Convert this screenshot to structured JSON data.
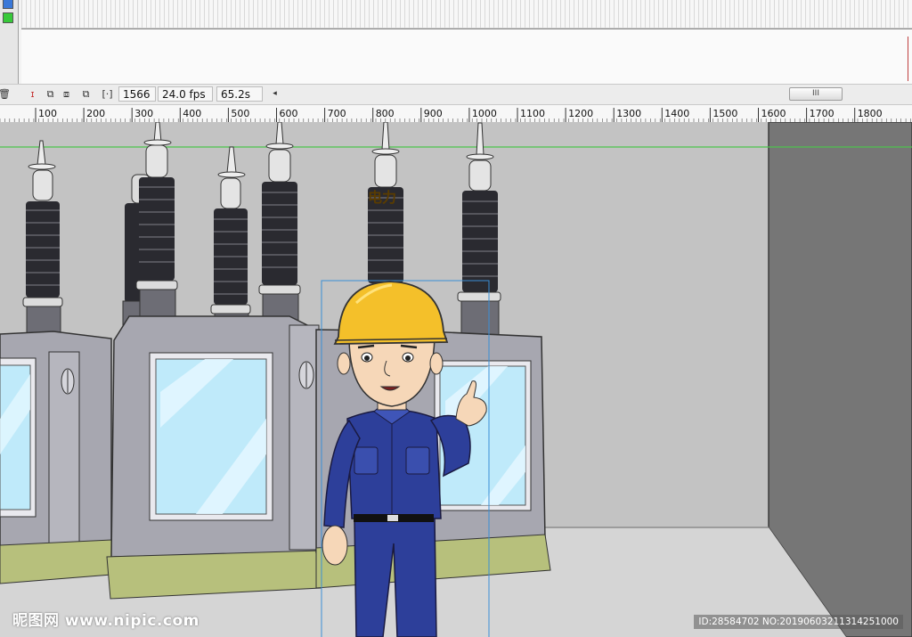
{
  "timeline": {
    "frame": "1566",
    "fps": "24.0 fps",
    "time": "65.2s",
    "scroll_label": "III",
    "layer_colors": [
      "#3a78d8",
      "#37c93a"
    ]
  },
  "ruler": {
    "ticks": [
      "100",
      "200",
      "300",
      "400",
      "500",
      "600",
      "700",
      "800",
      "900",
      "1000",
      "1100",
      "1200",
      "1300",
      "1400",
      "1500",
      "1600",
      "1700",
      "1800"
    ]
  },
  "scene": {
    "helmet_label": "电力",
    "colors": {
      "wall": "#c3c3c3",
      "side_wall": "#767676",
      "floor": "#d5d5d5",
      "helmet": "#f4c02a",
      "uniform": "#2d3f9a",
      "glass": "#bfeafa",
      "cabinet": "#a7a7b0",
      "insulator": "#2a2a30",
      "base": "#b7c07c"
    }
  },
  "watermark": {
    "left": "昵图网 www.nipic.com",
    "right": "ID:28584702 NO:20190603211314251000"
  }
}
